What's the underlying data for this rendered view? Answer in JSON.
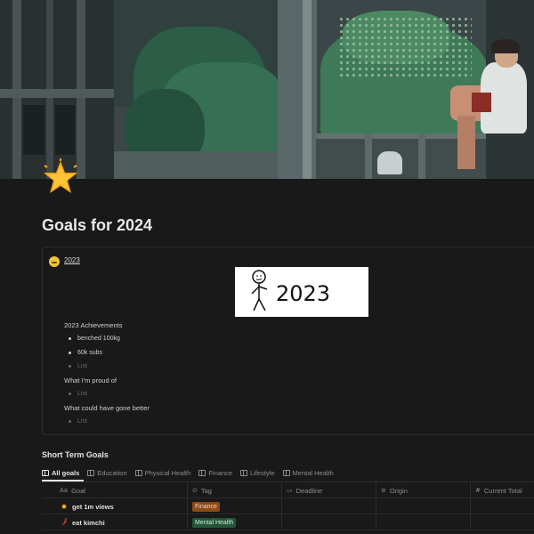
{
  "page": {
    "icon": "star-emoji",
    "title": "Goals for 2024"
  },
  "callout": {
    "emoji": "smirking-face-emoji",
    "title": "2023",
    "drawing_text": "2023",
    "achievements_heading": "2023 Achievements",
    "achievements": [
      "benched 100kg",
      "60k subs"
    ],
    "proud_heading": "What I'm proud of",
    "better_heading": "What could have gone better",
    "list_placeholder": "List"
  },
  "database": {
    "title": "Short Term Goals",
    "tabs": [
      {
        "label": "All goals",
        "active": true
      },
      {
        "label": "Education",
        "active": false
      },
      {
        "label": "Physical Health",
        "active": false
      },
      {
        "label": "Finance",
        "active": false
      },
      {
        "label": "Lifestyle",
        "active": false
      },
      {
        "label": "Mental Health",
        "active": false
      }
    ],
    "columns": [
      {
        "icon": "Aa",
        "label": "Goal"
      },
      {
        "icon": "⊙",
        "label": "Tag"
      },
      {
        "icon": "▭",
        "label": "Deadline"
      },
      {
        "icon": "≡",
        "label": "Origin"
      },
      {
        "icon": "#",
        "label": "Current Total"
      }
    ],
    "rows": [
      {
        "icon": "sun-emoji",
        "goal": "get 1m views",
        "tag": "Finance",
        "tag_color": "#8c4a15",
        "tag_text_color": "#f3d6bd"
      },
      {
        "icon": "chili-pepper-emoji",
        "goal": "eat kimchi",
        "tag": "Mental Health",
        "tag_color": "#24543a",
        "tag_text_color": "#c9ecd5"
      }
    ]
  },
  "colors": {
    "background": "#191919",
    "text": "#d4d4d4",
    "muted": "#8d8d8d"
  }
}
